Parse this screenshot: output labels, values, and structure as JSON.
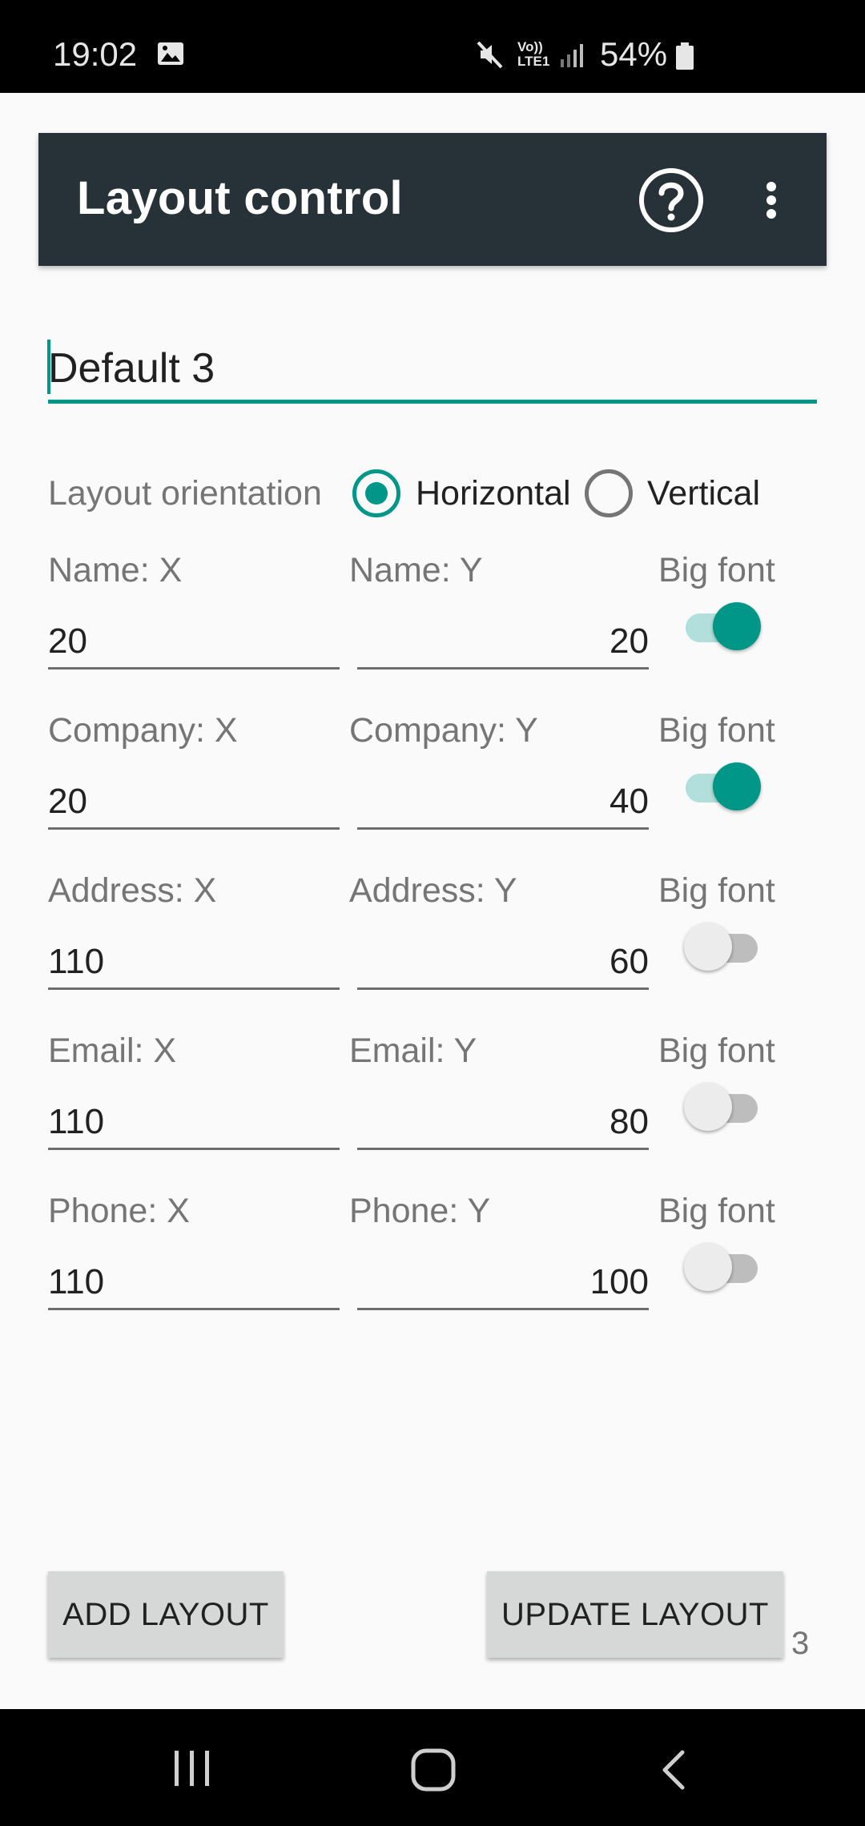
{
  "status_bar": {
    "time": "19:02",
    "volte_line1": "Vo))",
    "volte_line2": "LTE1",
    "battery": "54%",
    "icons": [
      "image-icon",
      "mute-icon",
      "volte-icon",
      "signal-icon",
      "battery-icon"
    ]
  },
  "app_bar": {
    "title": "Layout control",
    "help_icon": "help-circle-icon",
    "menu_icon": "more-vert-icon",
    "background": "#263238"
  },
  "layout_name": "Default 3",
  "orientation": {
    "label": "Layout orientation",
    "options": [
      {
        "label": "Horizontal",
        "selected": true
      },
      {
        "label": "Vertical",
        "selected": false
      }
    ]
  },
  "big_font_label": "Big font",
  "rows": [
    {
      "x_label": "Name: X",
      "y_label": "Name: Y",
      "x": "20",
      "y": "20",
      "big_font": true
    },
    {
      "x_label": "Company: X",
      "y_label": "Company: Y",
      "x": "20",
      "y": "40",
      "big_font": true
    },
    {
      "x_label": "Address: X",
      "y_label": "Address: Y",
      "x": "110",
      "y": "60",
      "big_font": false
    },
    {
      "x_label": "Email: X",
      "y_label": "Email: Y",
      "x": "110",
      "y": "80",
      "big_font": false
    },
    {
      "x_label": "Phone: X",
      "y_label": "Phone: Y",
      "x": "110",
      "y": "100",
      "big_font": false
    }
  ],
  "buttons": {
    "add": "ADD LAYOUT",
    "update": "UPDATE LAYOUT"
  },
  "layout_count": "3",
  "nav_bar": {
    "icons": [
      "recents-icon",
      "home-icon",
      "back-icon"
    ]
  },
  "colors": {
    "accent": "#009688",
    "accent_light": "#b2dfdb"
  }
}
